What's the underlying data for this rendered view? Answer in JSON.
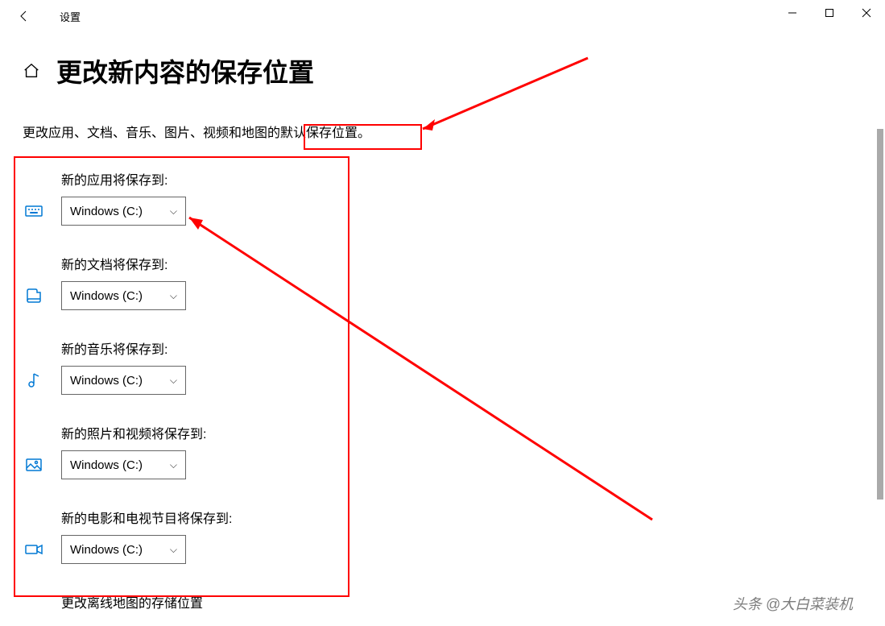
{
  "window": {
    "title": "设置"
  },
  "page": {
    "title": "更改新内容的保存位置",
    "description": "更改应用、文档、音乐、图片、视频和地图的默认保存位置。"
  },
  "settings": [
    {
      "label": "新的应用将保存到:",
      "value": "Windows (C:)",
      "icon": "keyboard"
    },
    {
      "label": "新的文档将保存到:",
      "value": "Windows (C:)",
      "icon": "document"
    },
    {
      "label": "新的音乐将保存到:",
      "value": "Windows (C:)",
      "icon": "music"
    },
    {
      "label": "新的照片和视频将保存到:",
      "value": "Windows (C:)",
      "icon": "picture"
    },
    {
      "label": "新的电影和电视节目将保存到:",
      "value": "Windows (C:)",
      "icon": "video"
    }
  ],
  "offline_maps": "更改离线地图的存储位置",
  "watermark": "头条 @大白菜装机",
  "annotations": {
    "color": "#FF0000"
  }
}
